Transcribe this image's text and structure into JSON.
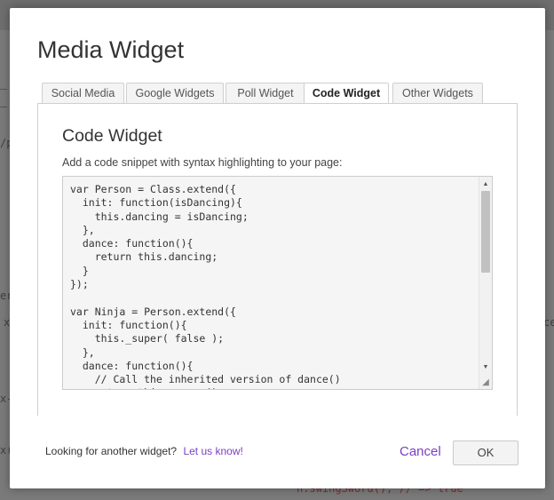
{
  "background": {
    "fragments": [
      {
        "text": "/p",
        "red": false
      },
      {
        "text": "er",
        "red": false
      },
      {
        "text": "x",
        "red": false
      },
      {
        "text": "ce",
        "red": false
      },
      {
        "text": "x-",
        "red": false
      },
      {
        "text": "x(",
        "red": false
      },
      {
        "text": "n.swingSword(); // => true",
        "red": true
      }
    ]
  },
  "modal": {
    "title": "Media Widget",
    "tabs": [
      {
        "label": "Social Media",
        "active": false
      },
      {
        "label": "Google Widgets",
        "active": false
      },
      {
        "label": "Poll Widget",
        "active": false
      },
      {
        "label": "Code Widget",
        "active": true
      },
      {
        "label": "Other Widgets",
        "active": false
      }
    ],
    "panel": {
      "title": "Code Widget",
      "description": "Add a code snippet with syntax highlighting to your page:",
      "code": "var Person = Class.extend({\n  init: function(isDancing){\n    this.dancing = isDancing;\n  },\n  dance: function(){\n    return this.dancing;\n  }\n});\n\nvar Ninja = Person.extend({\n  init: function(){\n    this._super( false );\n  },\n  dance: function(){\n    // Call the inherited version of dance()\n    return this._super();\n  },\n  swingSword: function(){\n    return true;\n  }\n});"
    },
    "footer": {
      "prompt": "Looking for another widget?",
      "link": "Let us know!",
      "cancel_label": "Cancel",
      "ok_label": "OK"
    }
  },
  "icons": {
    "scroll_up": "scroll-up-arrow-icon",
    "scroll_down": "scroll-down-arrow-icon",
    "resize": "resize-grip-icon"
  },
  "colors": {
    "accent": "#7b3fc4",
    "overlay": "#7a7a7a"
  }
}
